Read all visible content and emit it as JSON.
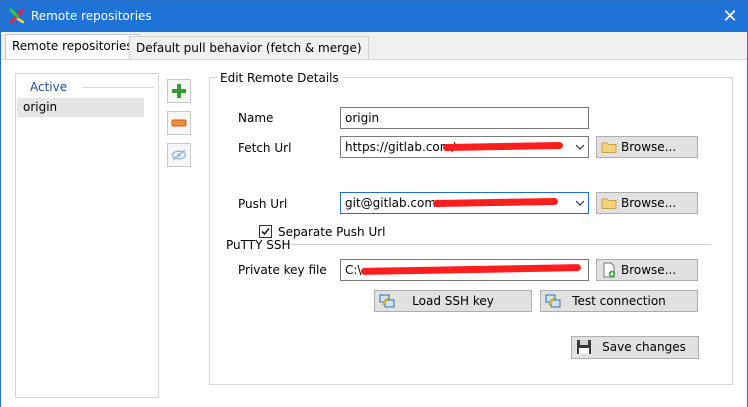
{
  "window": {
    "title": "Remote repositories",
    "close_symbol": "✕"
  },
  "tabs": [
    {
      "label": "Remote repositories",
      "active": true
    },
    {
      "label": "Default pull behavior (fetch & merge)",
      "active": false
    }
  ],
  "remotes_list": {
    "header": "Active",
    "items": [
      "origin"
    ]
  },
  "side_buttons": [
    "add-remote",
    "remove-remote",
    "toggle-visibility"
  ],
  "details": {
    "group_title": "Edit Remote Details",
    "name_label": "Name",
    "name_value": "origin",
    "fetch_label": "Fetch Url",
    "fetch_value": "https://gitlab.com/",
    "separate_push_label": "Separate Push Url",
    "separate_push_checked": true,
    "push_label": "Push Url",
    "push_value": "git@gitlab.com:",
    "browse_label": "Browse...",
    "putty_title": "PuTTY SSH",
    "private_key_label": "Private key file",
    "private_key_value": "C:\\",
    "load_ssh_label": "Load SSH key",
    "test_connection_label": "Test connection",
    "save_label": "Save changes"
  },
  "colors": {
    "titlebar": "#1f73d6",
    "redaction": "#ff1e1e",
    "accent_text": "#1b4f9c"
  }
}
